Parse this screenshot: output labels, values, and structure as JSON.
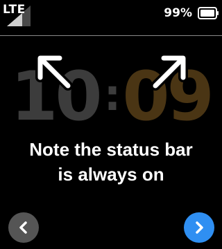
{
  "status_bar": {
    "network_label": "LTE",
    "battery_percent": "99%",
    "signal_icon": "signal-strength-icon",
    "battery_icon": "battery-full-icon"
  },
  "clock": {
    "hours": "10",
    "separator": ":",
    "minutes": "09"
  },
  "message": {
    "line1": "Note the status bar",
    "line2": "is always on"
  },
  "navigation": {
    "back_icon": "chevron-left-icon",
    "next_icon": "chevron-right-icon"
  },
  "colors": {
    "background": "#000000",
    "next_button": "#2f8ff2",
    "back_button": "#555555",
    "clock_hours": "#3c3c3c",
    "clock_minutes": "#4a3514"
  }
}
